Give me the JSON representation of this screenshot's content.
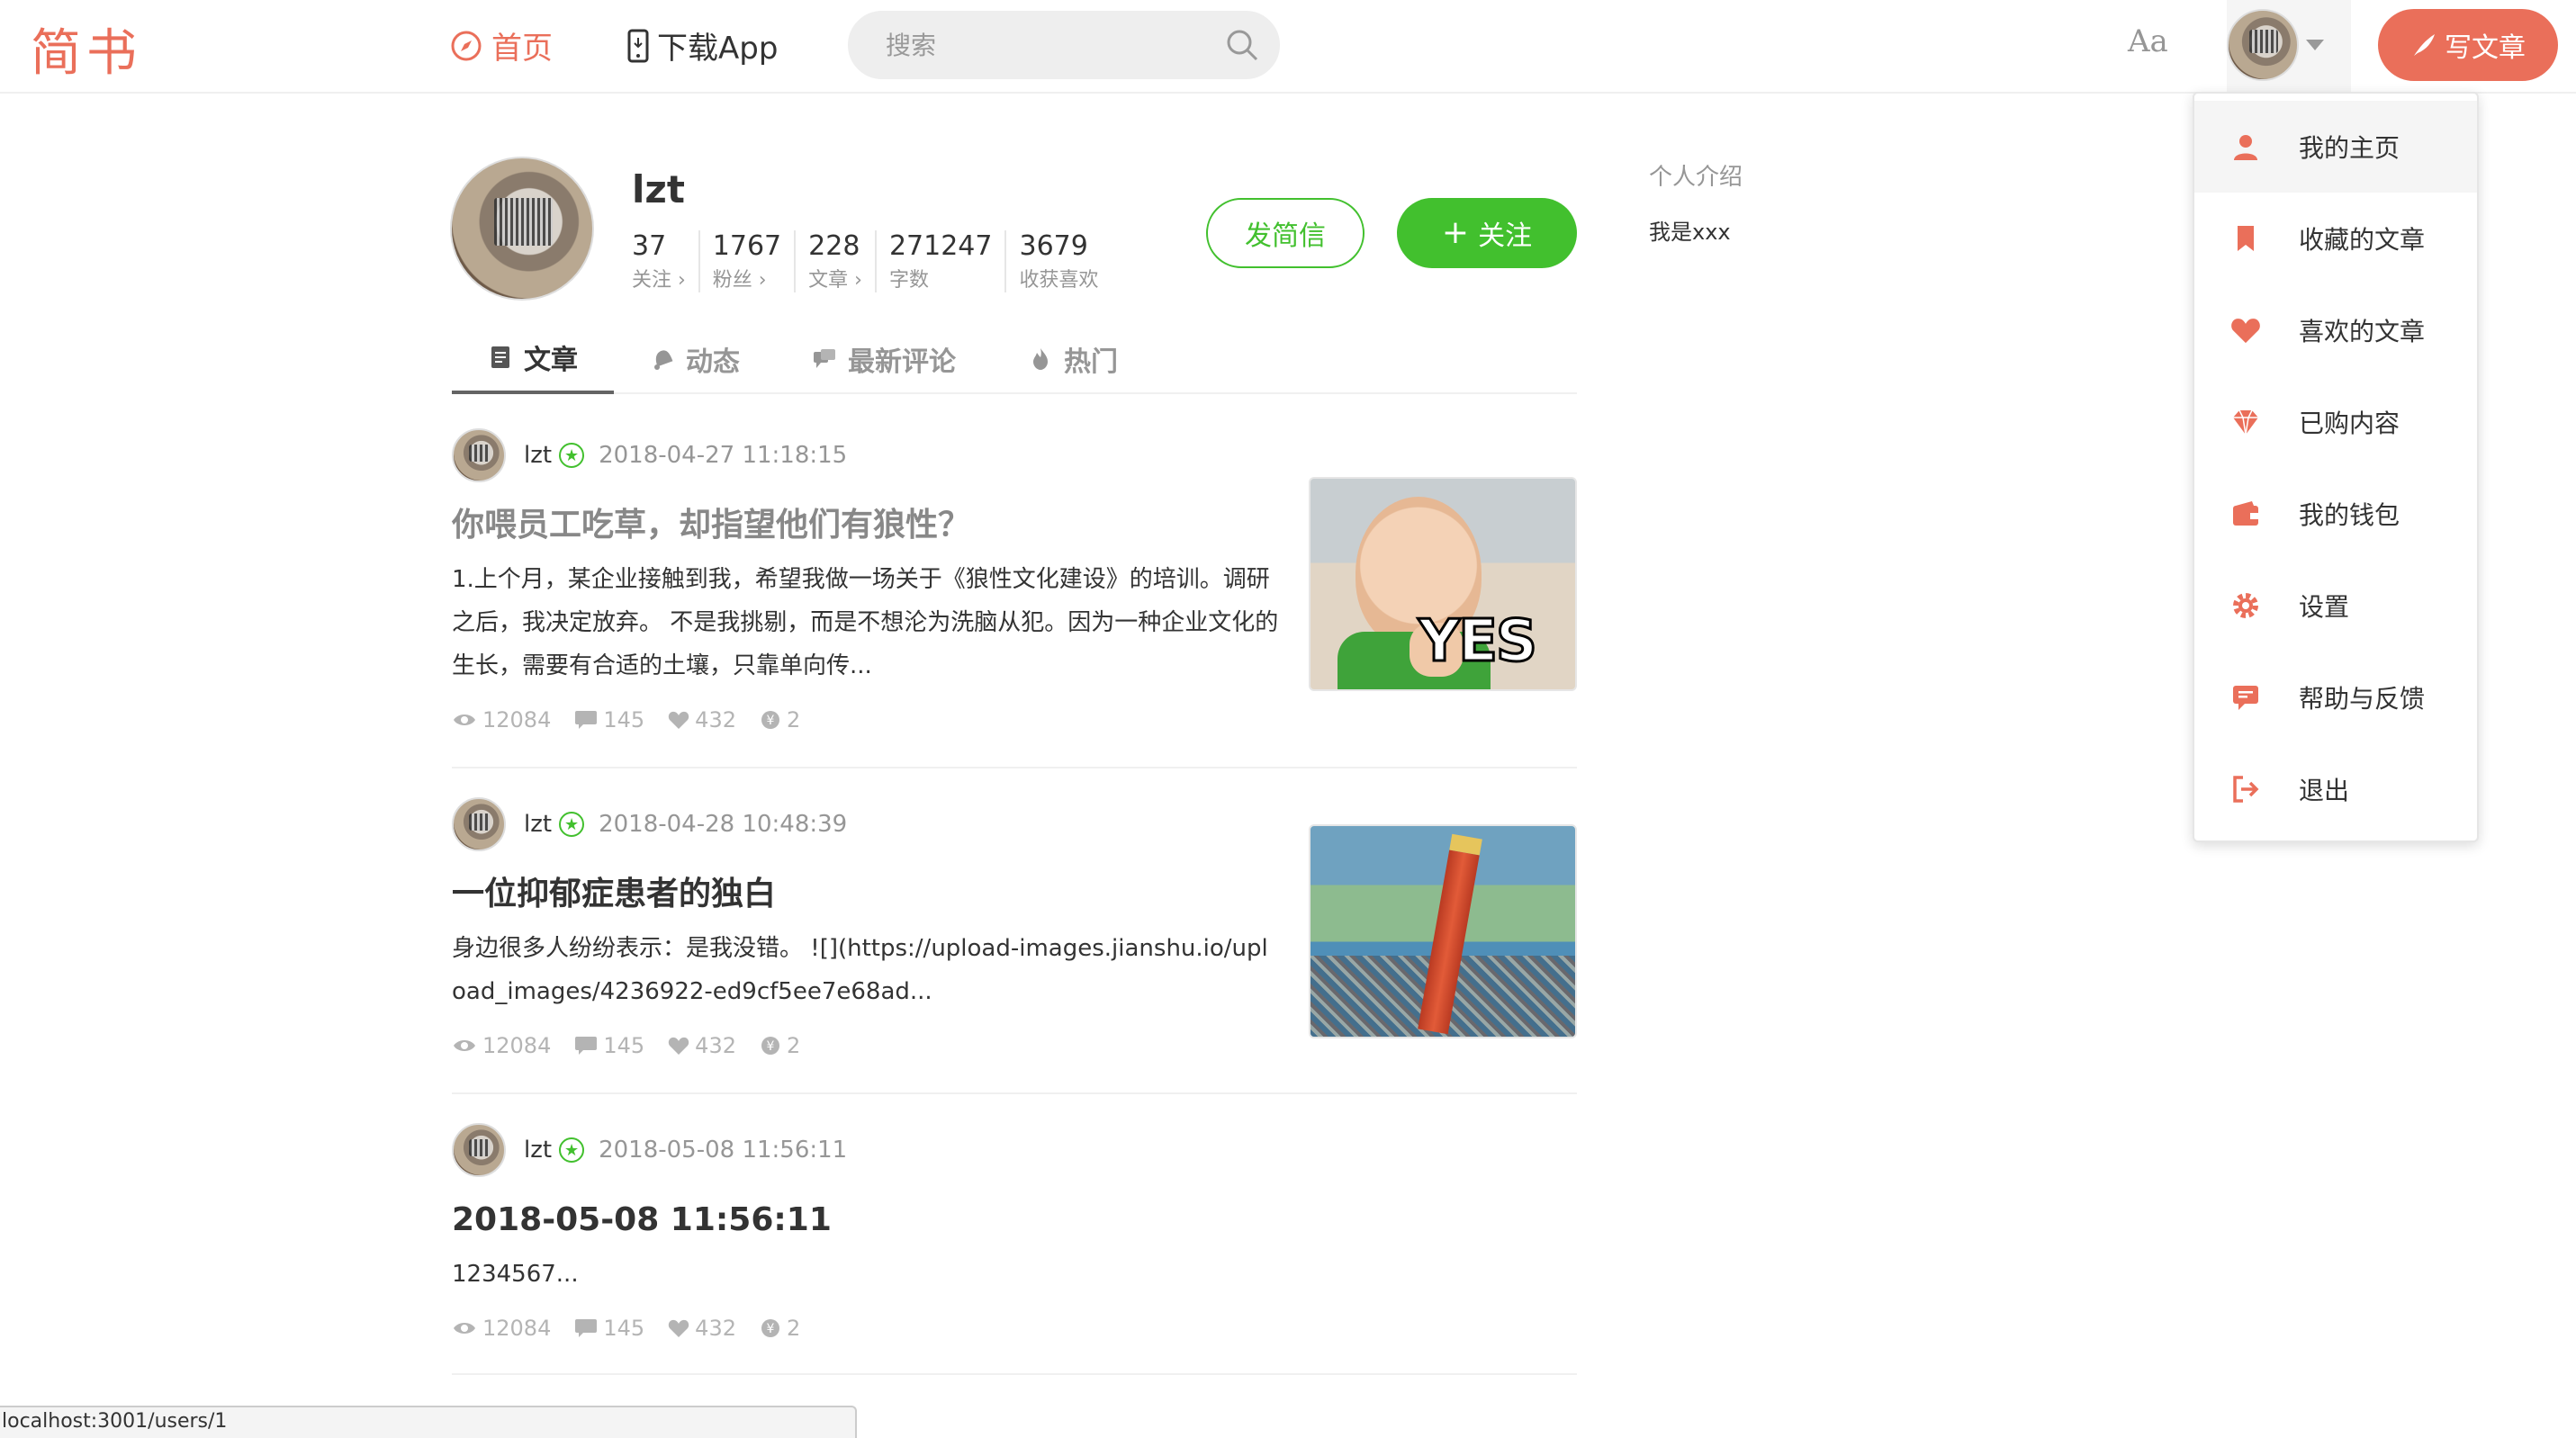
{
  "header": {
    "logo": "简书",
    "nav_home": "首页",
    "nav_download": "下载App",
    "search_placeholder": "搜索",
    "font_toggle": "Aa",
    "write_button": "写文章"
  },
  "profile": {
    "name": "lzt",
    "stats": [
      {
        "num": "37",
        "label": "关注 ›"
      },
      {
        "num": "1767",
        "label": "粉丝 ›"
      },
      {
        "num": "228",
        "label": "文章 ›"
      },
      {
        "num": "271247",
        "label": "字数"
      },
      {
        "num": "3679",
        "label": "收获喜欢"
      }
    ],
    "message_button": "发简信",
    "follow_button": "关注"
  },
  "tabs": [
    {
      "label": "文章",
      "icon": "article-icon",
      "active": true
    },
    {
      "label": "动态",
      "icon": "bell-icon",
      "active": false
    },
    {
      "label": "最新评论",
      "icon": "comments-icon",
      "active": false
    },
    {
      "label": "热门",
      "icon": "fire-icon",
      "active": false
    }
  ],
  "articles": [
    {
      "author": "lzt",
      "time": "2018-04-27 11:18:15",
      "title": "你喂员工吃草，却指望他们有狼性？",
      "abstract": "1.上个月，某企业接触到我，希望我做一场关于《狼性文化建设》的培训。调研之后，我决定放弃。 不是我挑剔，而是不想沦为洗脑从犯。因为一种企业文化的生长，需要有合适的土壤，只靠单向传...",
      "views": "12084",
      "comments": "145",
      "likes": "432",
      "rewards": "2",
      "thumb_text": "YES"
    },
    {
      "author": "lzt",
      "time": "2018-04-28 10:48:39",
      "title": "一位抑郁症患者的独白",
      "abstract": "身边很多人纷纷表示：是我没错。 ![](https://upload-images.jianshu.io/upload_images/4236922-ed9cf5ee7e68ad...",
      "views": "12084",
      "comments": "145",
      "likes": "432",
      "rewards": "2"
    },
    {
      "author": "lzt",
      "time": "2018-05-08 11:56:11",
      "title": "2018-05-08 11:56:11",
      "abstract": "1234567...",
      "views": "12084",
      "comments": "145",
      "likes": "432",
      "rewards": "2"
    }
  ],
  "sidebar": {
    "intro_title": "个人介绍",
    "intro_text": "我是xxx"
  },
  "dropdown": [
    {
      "label": "我的主页",
      "icon": "user-icon"
    },
    {
      "label": "收藏的文章",
      "icon": "bookmark-icon"
    },
    {
      "label": "喜欢的文章",
      "icon": "heart-icon"
    },
    {
      "label": "已购内容",
      "icon": "diamond-icon"
    },
    {
      "label": "我的钱包",
      "icon": "wallet-icon"
    },
    {
      "label": "设置",
      "icon": "gear-icon"
    },
    {
      "label": "帮助与反馈",
      "icon": "feedback-icon"
    },
    {
      "label": "退出",
      "icon": "logout-icon"
    }
  ],
  "status_url": "localhost:3001/users/1",
  "colors": {
    "brand": "#ea6f5a",
    "green": "#42c02e"
  }
}
